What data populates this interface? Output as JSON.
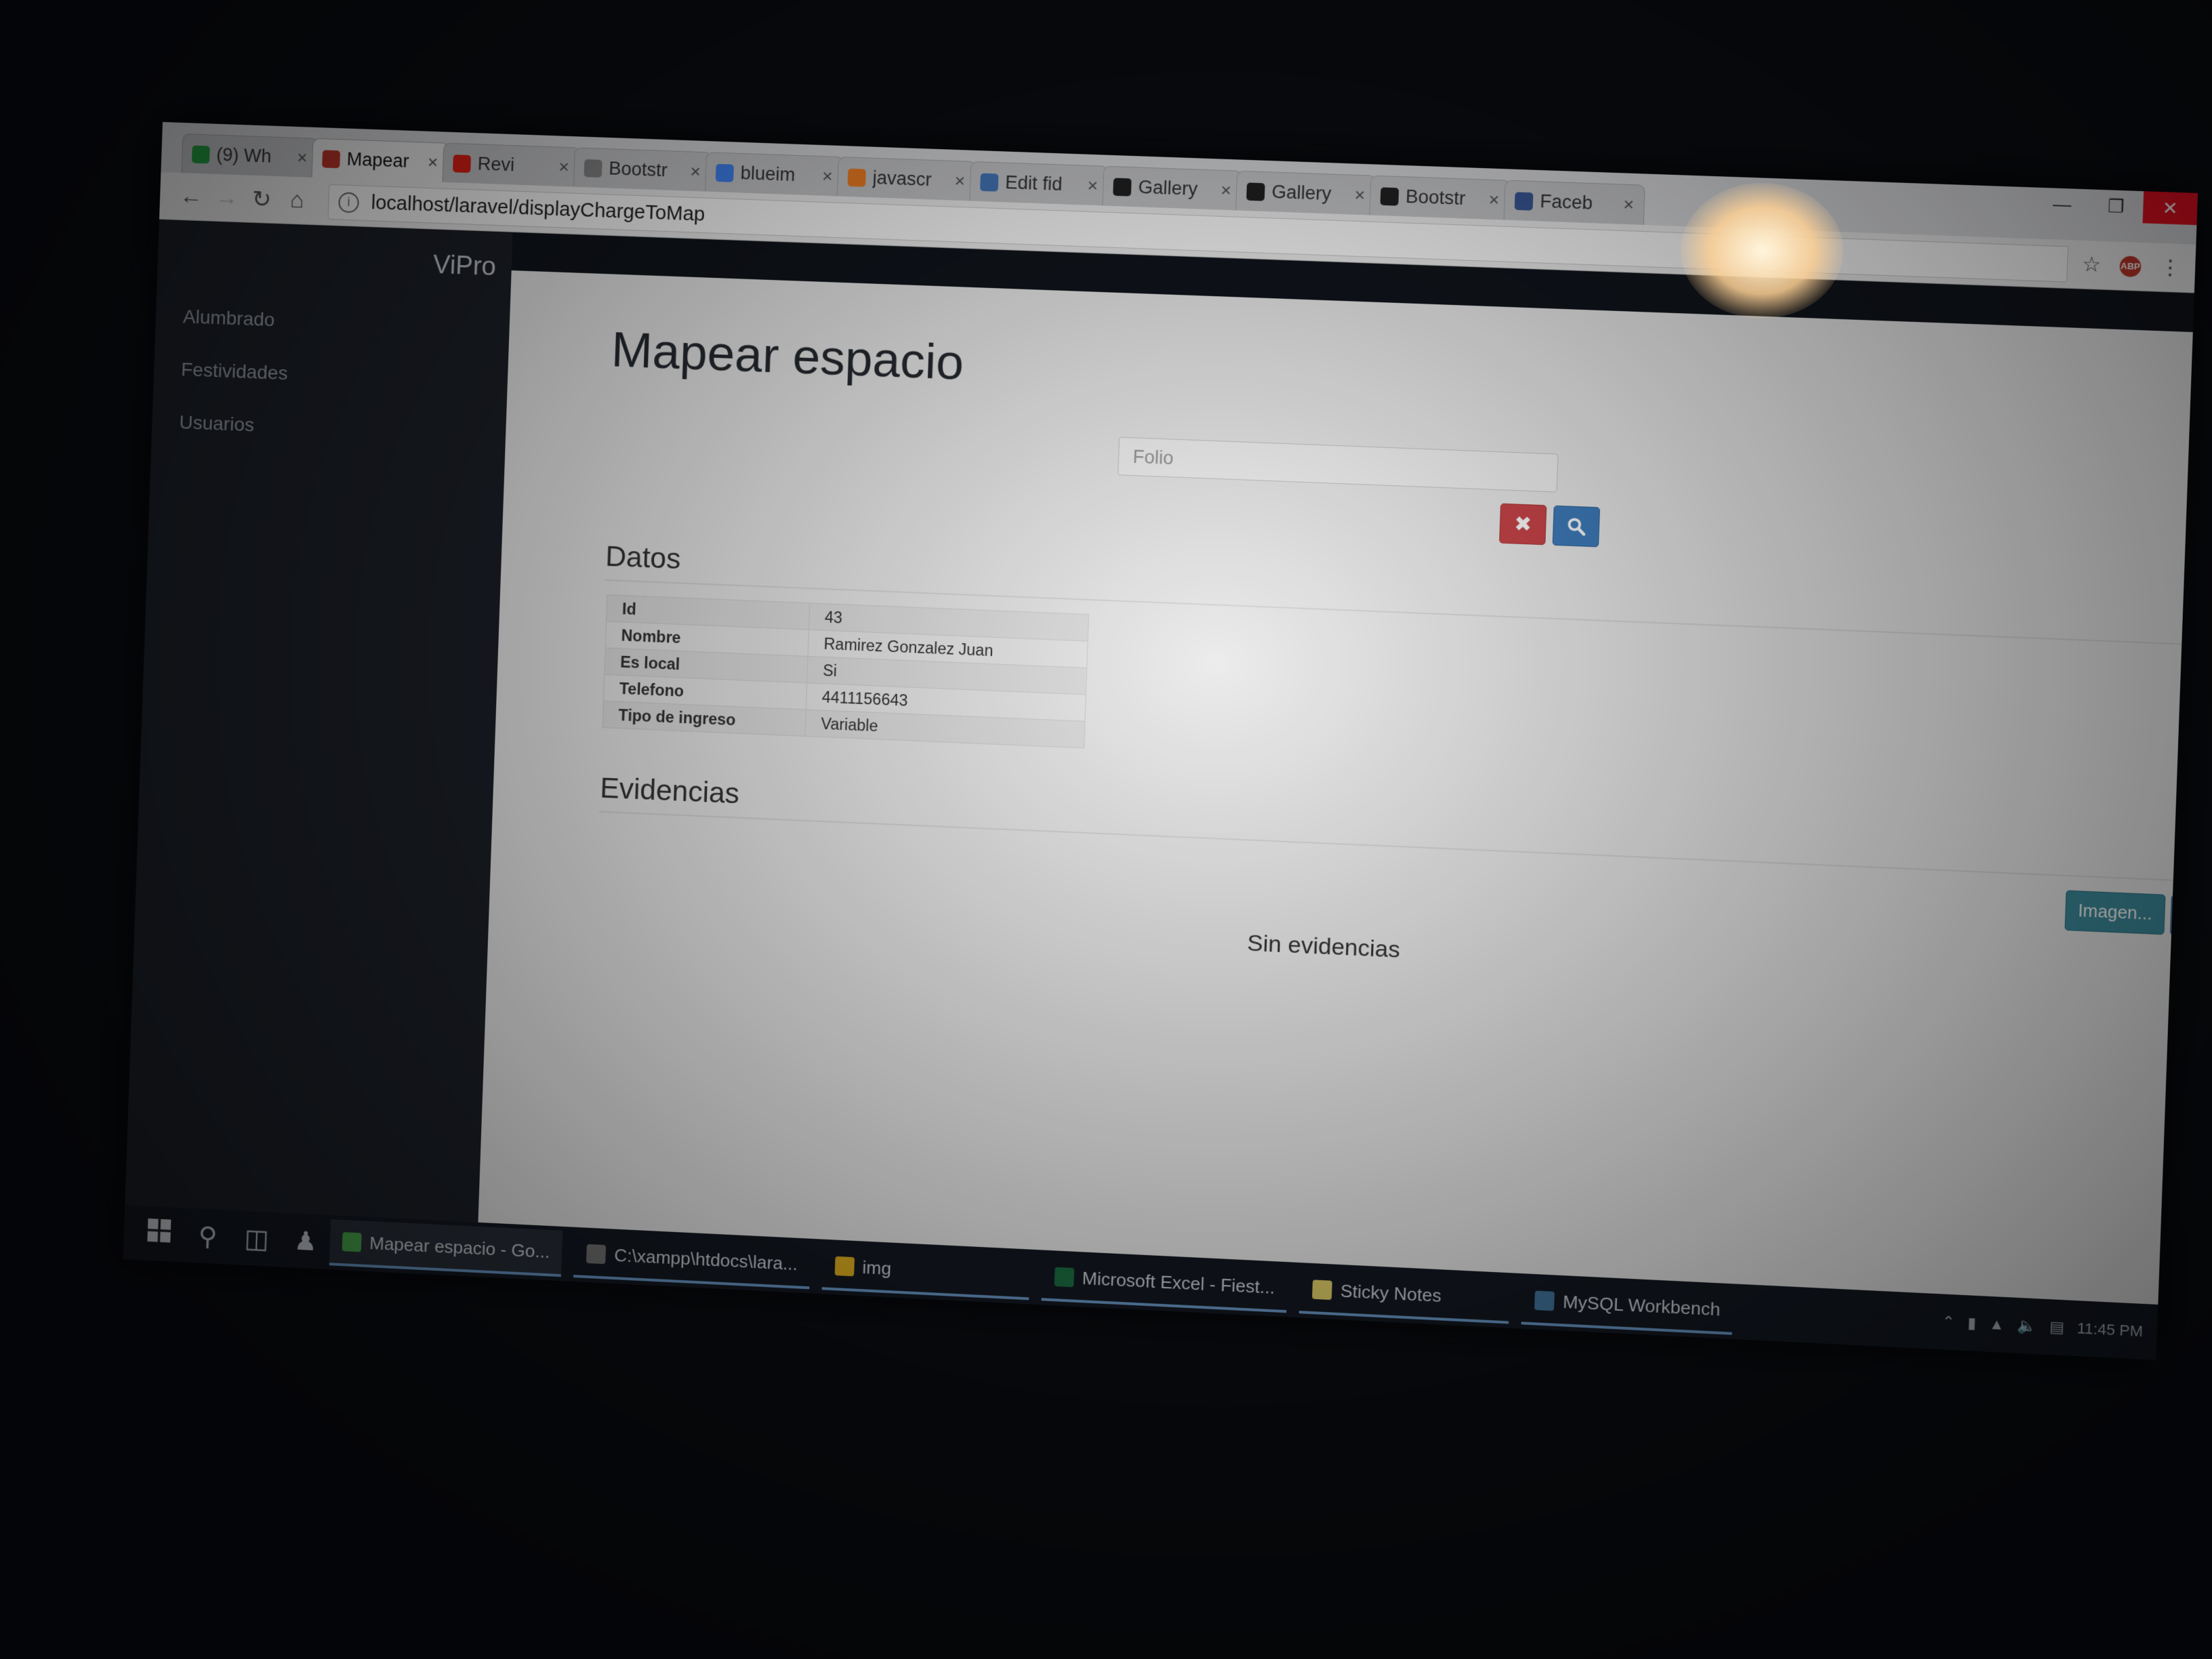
{
  "browser": {
    "tabs": [
      {
        "title": "(9) Wh",
        "favicon": "whatsapp-icon",
        "color": "#25a244"
      },
      {
        "title": "Mapear",
        "favicon": "xampp-icon",
        "color": "#c0392b"
      },
      {
        "title": "Revi",
        "favicon": "youtube-icon",
        "color": "#e62117"
      },
      {
        "title": "Bootstr",
        "favicon": "page-icon",
        "color": "#888888"
      },
      {
        "title": "blueim",
        "favicon": "google-icon",
        "color": "#4285f4"
      },
      {
        "title": "javascr",
        "favicon": "stackoverflow-icon",
        "color": "#f48024"
      },
      {
        "title": "Edit fid",
        "favicon": "jsfiddle-icon",
        "color": "#4679bd"
      },
      {
        "title": "Gallery",
        "favicon": "github-icon",
        "color": "#222222"
      },
      {
        "title": "Gallery",
        "favicon": "github-icon",
        "color": "#222222"
      },
      {
        "title": "Bootstr",
        "favicon": "github-icon",
        "color": "#222222"
      },
      {
        "title": "Faceb",
        "favicon": "facebook-icon",
        "color": "#3b5998"
      }
    ],
    "url": "localhost/laravel/displayChargeToMap"
  },
  "sidebar": {
    "brand": "ViPro",
    "items": [
      {
        "label": "Alumbrado"
      },
      {
        "label": "Festividades"
      },
      {
        "label": "Usuarios"
      }
    ]
  },
  "main": {
    "title": "Mapear espacio",
    "folio_placeholder": "Folio",
    "datos_heading": "Datos",
    "datos": [
      {
        "key": "Id",
        "value": "43"
      },
      {
        "key": "Nombre",
        "value": "Ramirez Gonzalez Juan"
      },
      {
        "key": "Es local",
        "value": "Si"
      },
      {
        "key": "Telefono",
        "value": "4411156643"
      },
      {
        "key": "Tipo de ingreso",
        "value": "Variable"
      }
    ],
    "evidencias_heading": "Evidencias",
    "imagen_button": "Imagen...",
    "empty_text": "Sin evidencias"
  },
  "taskbar": {
    "apps": [
      {
        "label": "Mapear espacio - Go...",
        "icon": "chrome-icon",
        "color": "#4caf50",
        "active": true
      },
      {
        "label": "C:\\xampp\\htdocs\\lara...",
        "icon": "terminal-icon",
        "color": "#777777"
      },
      {
        "label": "img",
        "icon": "folder-icon",
        "color": "#e6b422"
      },
      {
        "label": "Microsoft Excel - Fiest...",
        "icon": "excel-icon",
        "color": "#1e7145"
      },
      {
        "label": "Sticky Notes",
        "icon": "sticky-notes-icon",
        "color": "#e8d46b"
      },
      {
        "label": "MySQL Workbench",
        "icon": "mysql-icon",
        "color": "#4479a1"
      }
    ],
    "clock": "11:45 PM"
  },
  "colors": {
    "danger": "#c9454a",
    "primary": "#3f7dbd",
    "info": "#3f8fa0",
    "sidebar_bg": "#1d2129",
    "content_bg": "#ebeceb"
  }
}
